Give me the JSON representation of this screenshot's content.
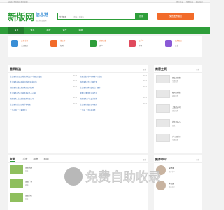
{
  "topbar": {
    "left": "欢迎来到新版分类信息网",
    "links": [
      "用户登录",
      "免费注册",
      "网站导航"
    ]
  },
  "header": {
    "logo_big": "新版网",
    "logo_mid": "信息港",
    "logo_small": "综合分类信息网",
    "search_category": "生活服务",
    "search_placeholder": "请输入关键字",
    "search_button": "搜索",
    "publish_button": "免费发布信息"
  },
  "nav": {
    "items": [
      "首页",
      "信息",
      "商家",
      "资产",
      "招商"
    ]
  },
  "categories": [
    {
      "t1": "二手市场",
      "t2": "生活服务",
      "color": "#3a8fd6"
    },
    {
      "t1": "找工作",
      "t2": "招聘",
      "color": "#f26b2a"
    },
    {
      "t1": "房屋出租",
      "t2": "房产",
      "color": "#2e9e3a"
    },
    {
      "t1": "二手车",
      "t2": "车辆",
      "color": "#e04a5d"
    },
    {
      "t1": "商务服务",
      "t2": "企业",
      "color": "#8a5ad6"
    }
  ],
  "latest": {
    "title": "首页精选",
    "more": "更多",
    "rows": [
      {
        "text": "[生活服务] 西安回收商场礼品卡 中国工商银行",
        "date": "08-10"
      },
      {
        "text": "[生活服务] 福州卖掉旧手机回收多少钱",
        "date": "08-10"
      },
      {
        "text": "[商务服务] 淮安市区家政公司招聘",
        "date": "08-10"
      },
      {
        "text": "[生活服务] 西安回收商场礼品卡 价格",
        "date": "08-10"
      },
      {
        "text": "[商务服务] 上海商务服务有限公司",
        "date": "08-10"
      },
      {
        "text": "[生活服务] 北京回收手机电脑",
        "date": "08-10"
      },
      {
        "text": "[二手市场] 二手家具转让",
        "date": "08-10"
      },
      {
        "text": "[房屋出租] 市中心两室一厅出租",
        "date": "08-10"
      },
      {
        "text": "[商务服务] 企业注册代理",
        "date": "08-10"
      },
      {
        "text": "[生活服务] 家电维修上门服务",
        "date": "08-10"
      },
      {
        "text": "[招聘] 招聘销售人员若干",
        "date": "08-10"
      },
      {
        "text": "[商务服务] 广告设计制作",
        "date": "08-10"
      },
      {
        "text": "[生活服务] 搬家公司服务",
        "date": "08-10"
      },
      {
        "text": "[二手车] 二手轿车出售",
        "date": "08-10"
      }
    ]
  },
  "shops": {
    "title": "商家主页",
    "more": "更多",
    "items": [
      {
        "name": "西安某商贸",
        "sub": "生活服务"
      },
      {
        "name": "福州某科技",
        "sub": "商务服务"
      },
      {
        "name": "上海某公司",
        "sub": "企业服务"
      },
      {
        "name": "北京某中心",
        "sub": "回收"
      },
      {
        "name": "广州某商行",
        "sub": "生活服务"
      }
    ]
  },
  "property": {
    "tabs": [
      "房源",
      "二手房",
      "租房",
      "商铺"
    ],
    "more": "更多",
    "items": [
      {
        "name": "某某花园",
        "sub": "住宅"
      },
      {
        "name": "某某广场",
        "sub": "商铺"
      },
      {
        "name": "某某小区",
        "sub": "住宅"
      }
    ]
  },
  "recommend": {
    "title": "推荐中介",
    "more": "更多",
    "items": [
      {
        "name": "张经理",
        "sub": "房产中介"
      },
      {
        "name": "李经理",
        "sub": "房产中介"
      }
    ]
  },
  "watermark": "免费自助收录"
}
